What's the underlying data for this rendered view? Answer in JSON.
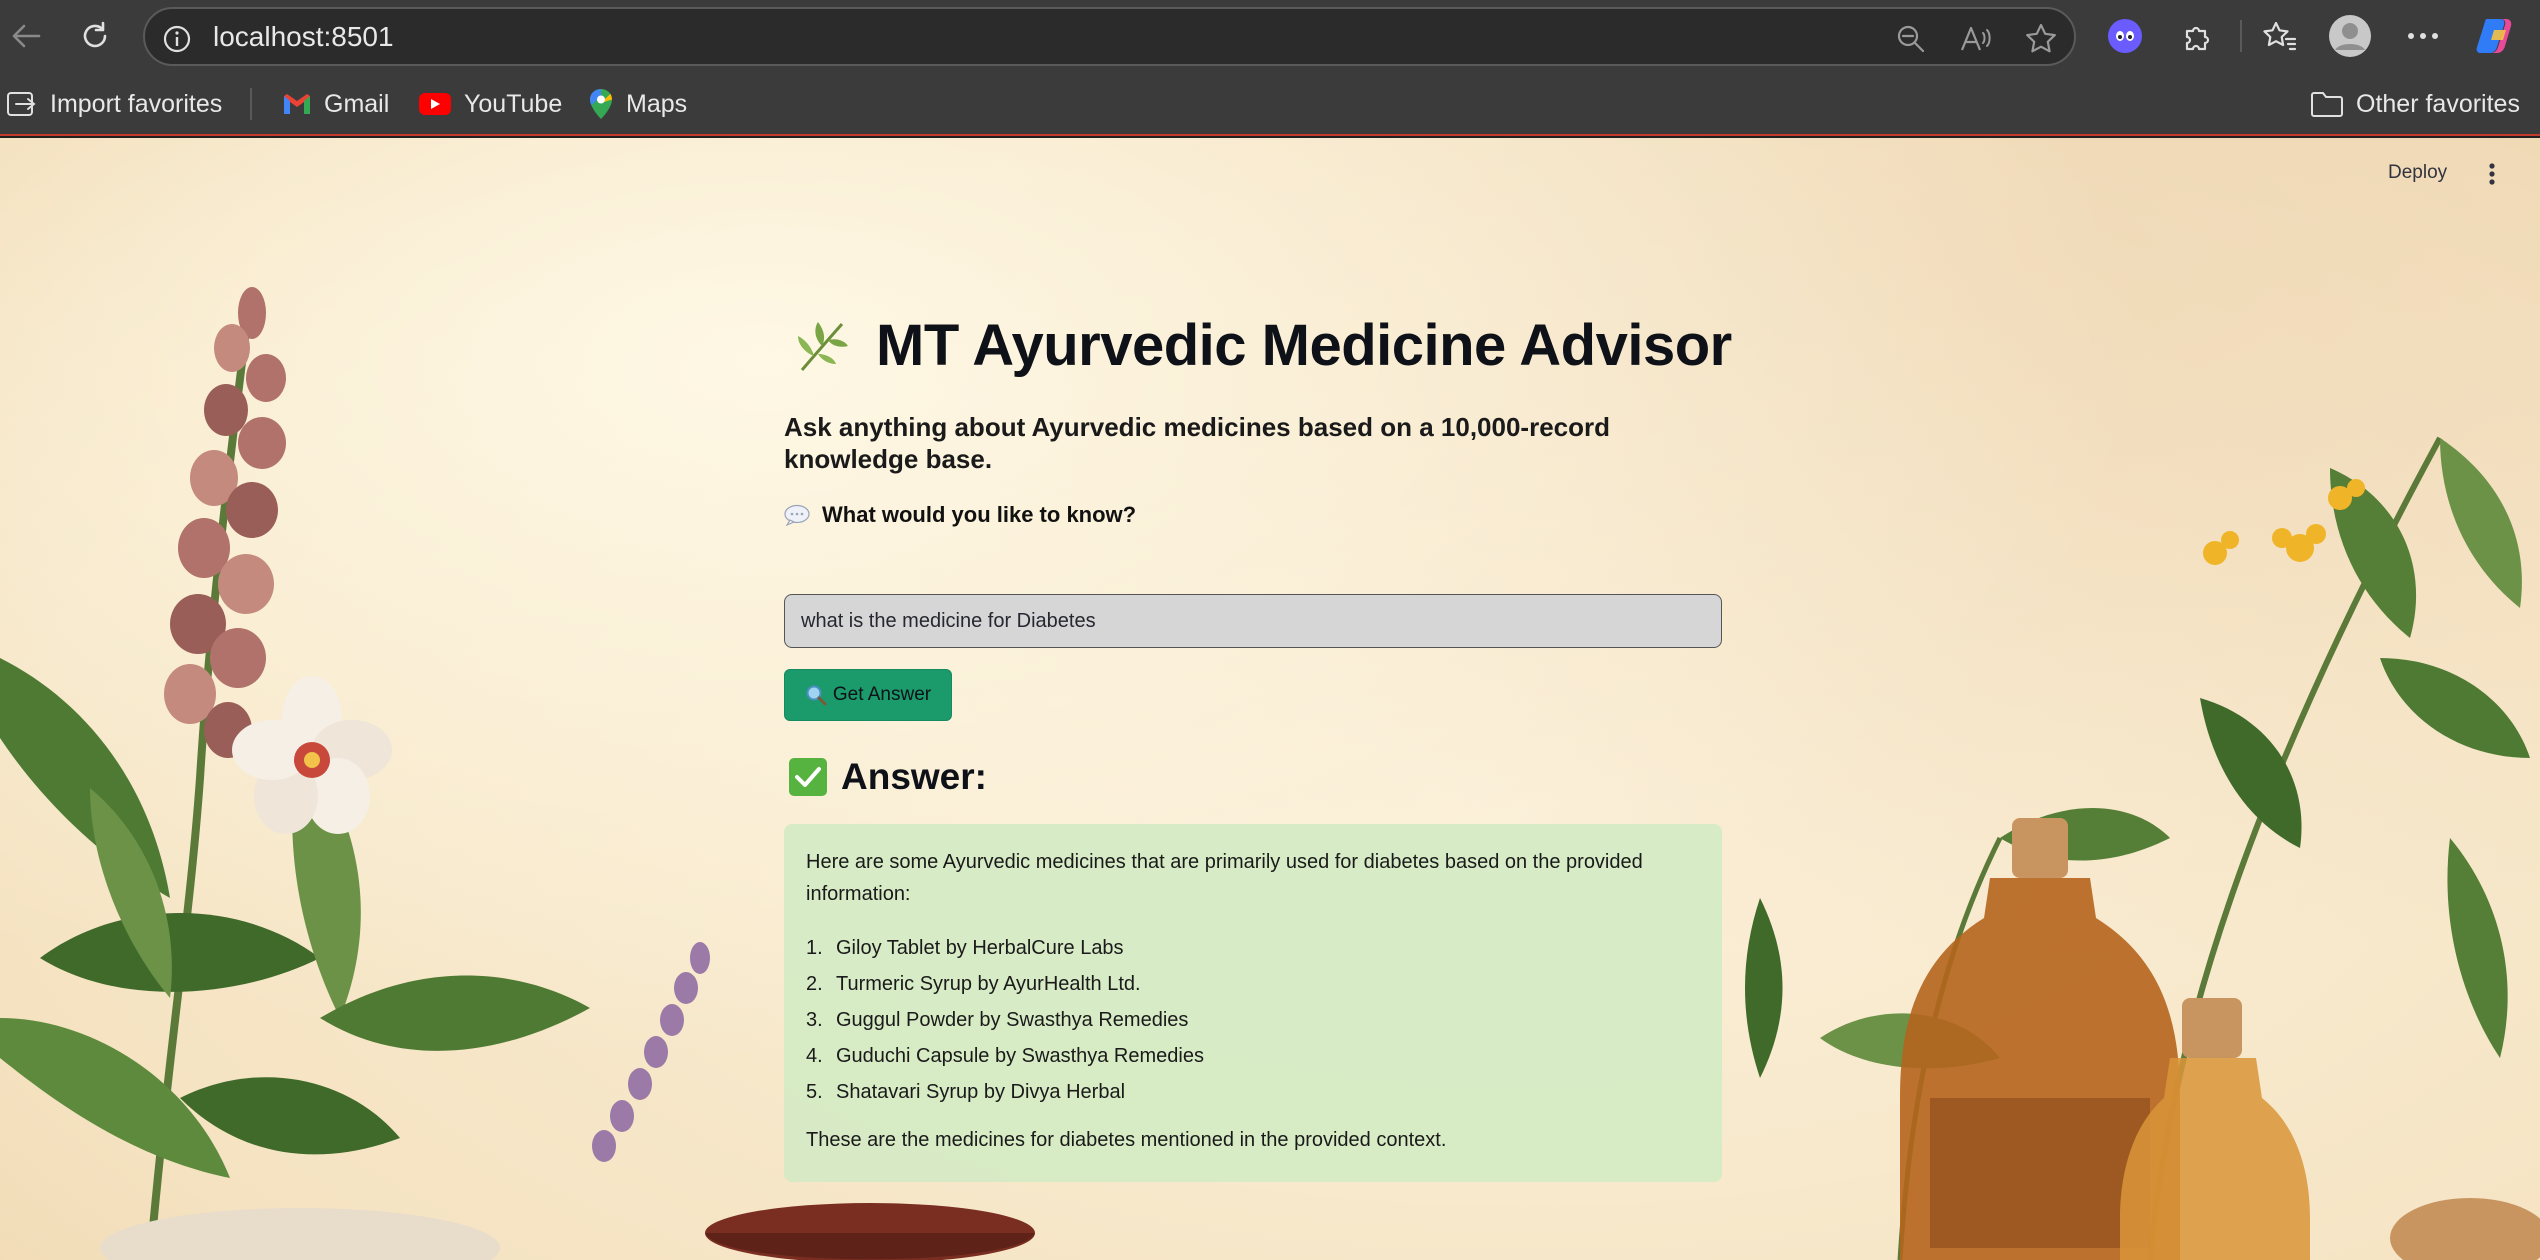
{
  "browser": {
    "url": "localhost:8501",
    "favorites": [
      {
        "label": "Import favorites",
        "icon": "import-icon"
      },
      {
        "label": "Gmail",
        "icon": "gmail-icon"
      },
      {
        "label": "YouTube",
        "icon": "youtube-icon"
      },
      {
        "label": "Maps",
        "icon": "maps-icon"
      }
    ],
    "other_favorites": "Other favorites"
  },
  "app": {
    "deploy_label": "Deploy",
    "title": "MT Ayurvedic Medicine Advisor",
    "subtitle": "Ask anything about Ayurvedic medicines based on a 10,000-record knowledge base.",
    "prompt_label": "What would you like to know?",
    "query_value": "what is the medicine for Diabetes",
    "button_label": "Get Answer",
    "answer_heading": "Answer:",
    "answer_intro": "Here are some Ayurvedic medicines that are primarily used for diabetes based on the provided information:",
    "answer_items": [
      {
        "num": "1.",
        "text": "Giloy Tablet by HerbalCure Labs"
      },
      {
        "num": "2.",
        "text": "Turmeric Syrup by AyurHealth Ltd."
      },
      {
        "num": "3.",
        "text": "Guggul Powder by Swasthya Remedies"
      },
      {
        "num": "4.",
        "text": "Guduchi Capsule by Swasthya Remedies"
      },
      {
        "num": "5.",
        "text": "Shatavari Syrup by Divya Herbal"
      }
    ],
    "answer_outro": "These are the medicines for diabetes mentioned in the provided context."
  },
  "colors": {
    "button_bg": "#1b9a6c",
    "answer_bg": "#d4eac4",
    "check": "#57b33f"
  }
}
